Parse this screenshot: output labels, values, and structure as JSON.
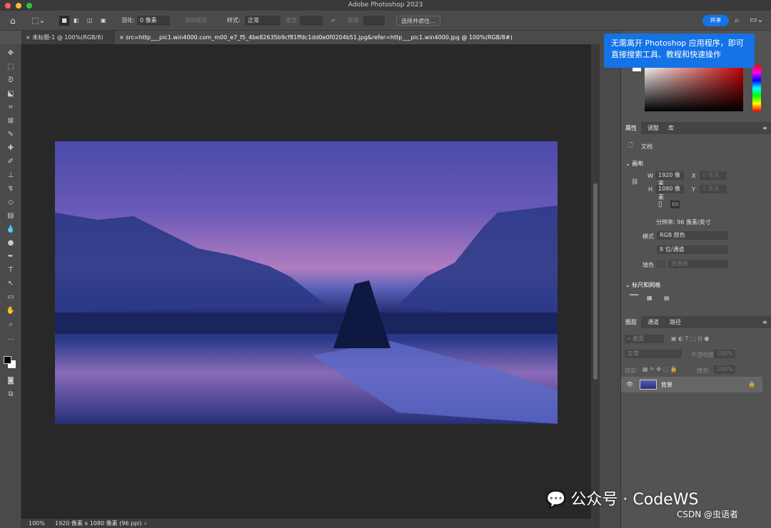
{
  "window": {
    "title": "Adobe Photoshop 2023"
  },
  "options": {
    "feather_label": "羽化:",
    "feather_value": "0 像素",
    "antialias": "消除锯齿",
    "style_label": "样式:",
    "style_value": "正常",
    "width_label": "宽度:",
    "height_label": "高度:",
    "select_mask": "选择并遮住..."
  },
  "header": {
    "share": "共享"
  },
  "tooltip": {
    "line1": "无需离开 Photoshop 应用程序，即可",
    "line2": "直接搜索工具、教程和快速操作"
  },
  "tabs": [
    {
      "label": "未标题-1 @ 100%(RGB/8)"
    },
    {
      "label": "src=http___pic1.win4000.com_m00_e7_f5_4be82635b9cf81ffdc1dd0e0f0204b51.jpg&refer=http___pic1.win4000.jpg @ 100%(RGB/8#)"
    }
  ],
  "status": {
    "zoom": "100%",
    "info": "1920 像素 x 1080 像素 (96 ppi)"
  },
  "properties": {
    "tabs": [
      "属性",
      "调整",
      "库"
    ],
    "doc": "文档",
    "canvas": "画布",
    "w_label": "W",
    "w": "1920 像素",
    "h_label": "H",
    "h": "1080 像素",
    "x_label": "X",
    "x": "0 像素",
    "y_label": "Y",
    "y": "0 像素",
    "resolution": "分辨率: 96 像素/英寸",
    "mode_label": "模式",
    "mode": "RGB 颜色",
    "depth": "8 位/通道",
    "fill_label": "填色",
    "fill": "背景色",
    "rulers": "标尺和网格"
  },
  "layers": {
    "tabs": [
      "图层",
      "通道",
      "路径"
    ],
    "filter": "类型",
    "blend": "正常",
    "opacity_label": "不透明度:",
    "opacity": "100%",
    "lock_label": "锁定:",
    "fill_label": "填充:",
    "fill": "100%",
    "items": [
      {
        "name": "背景"
      }
    ]
  },
  "watermark": {
    "wechat": "公众号 · CodeWS",
    "csdn": "CSDN @虫语者"
  },
  "colors": {
    "accent": "#1473e6"
  }
}
